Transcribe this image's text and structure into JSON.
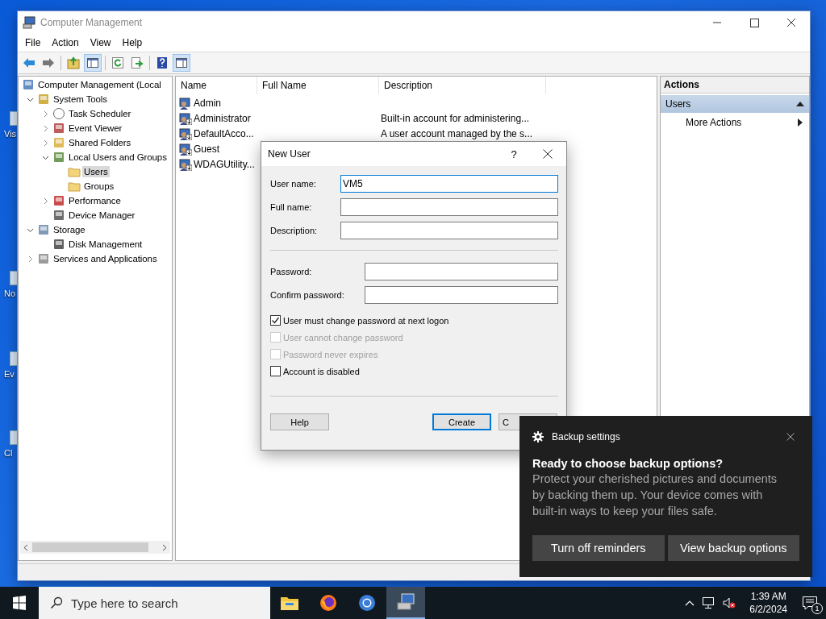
{
  "desktop_icons": [
    {
      "label": "Vis"
    },
    {
      "label": "No"
    },
    {
      "label": "Ev"
    },
    {
      "label": "Cl"
    }
  ],
  "window": {
    "title": "Computer Management"
  },
  "menu": [
    "File",
    "Action",
    "View",
    "Help"
  ],
  "toolbar": [
    [
      {
        "kind": "back",
        "on": false
      },
      {
        "kind": "forward",
        "on": false
      }
    ],
    [
      {
        "kind": "up",
        "on": false
      },
      {
        "kind": "tree",
        "on": true
      }
    ],
    [
      {
        "kind": "refresh",
        "on": false
      },
      {
        "kind": "export",
        "on": false
      }
    ],
    [
      {
        "kind": "help",
        "on": false
      },
      {
        "kind": "pane",
        "on": true
      }
    ]
  ],
  "tree": [
    {
      "label": "Computer Management (Local",
      "kind": "computer",
      "selected": false,
      "children": [
        {
          "label": "System Tools",
          "kind": "tools",
          "expanded": true,
          "selected": false,
          "children": [
            {
              "label": "Task Scheduler",
              "kind": "clock",
              "expanded": false,
              "selected": false
            },
            {
              "label": "Event Viewer",
              "kind": "event",
              "expanded": false,
              "selected": false
            },
            {
              "label": "Shared Folders",
              "kind": "share",
              "expanded": false,
              "selected": false
            },
            {
              "label": "Local Users and Groups",
              "kind": "users",
              "expanded": true,
              "selected": false,
              "children": [
                {
                  "label": "Users",
                  "kind": "folder",
                  "selected": true
                },
                {
                  "label": "Groups",
                  "kind": "folder",
                  "selected": false
                }
              ]
            },
            {
              "label": "Performance",
              "kind": "perf",
              "expanded": false,
              "selected": false
            },
            {
              "label": "Device Manager",
              "kind": "device",
              "selected": false
            }
          ]
        },
        {
          "label": "Storage",
          "kind": "storage",
          "expanded": true,
          "selected": false,
          "children": [
            {
              "label": "Disk Management",
              "kind": "disk",
              "selected": false
            }
          ]
        },
        {
          "label": "Services and Applications",
          "kind": "services",
          "expanded": false,
          "selected": false
        }
      ]
    }
  ],
  "list": {
    "columns": [
      "Name",
      "Full Name",
      "Description"
    ],
    "rows": [
      {
        "name": "Admin",
        "disabled": false
      },
      {
        "name": "Administrator",
        "description": "Built-in account for administering...",
        "disabled": true
      },
      {
        "name": "DefaultAcco...",
        "description": "A user account managed by the s...",
        "disabled": true
      },
      {
        "name": "Guest",
        "disabled": true
      },
      {
        "name": "WDAGUtility...",
        "disabled": true
      }
    ]
  },
  "actions": {
    "header": "Actions",
    "section": {
      "label": "Users",
      "expanded": true
    },
    "items": [
      "More Actions"
    ]
  },
  "dialog": {
    "title": "New User",
    "help": "?",
    "name_fields": [
      {
        "label": "User name:",
        "value": "VM5",
        "focused": true
      },
      {
        "label": "Full name:",
        "focused": false
      },
      {
        "label": "Description:",
        "focused": false
      }
    ],
    "password_fields": [
      {
        "label": "Password:",
        "focused": false
      },
      {
        "label": "Confirm password:",
        "focused": false
      }
    ],
    "checkboxes": [
      {
        "label": "User must change password at next logon",
        "checked": true,
        "disabled": false
      },
      {
        "label": "User cannot change password",
        "checked": false,
        "disabled": true
      },
      {
        "label": "Password never expires",
        "checked": false,
        "disabled": true
      },
      {
        "label": "Account is disabled",
        "checked": false,
        "disabled": false
      }
    ],
    "buttons": [
      {
        "label": "Help",
        "default": false
      },
      {
        "label": "Create",
        "default": true
      },
      {
        "label": "C",
        "default": false
      }
    ]
  },
  "toast": {
    "app": "Backup settings",
    "title": "Ready to choose backup options?",
    "body": "Protect your cherished pictures and documents by backing them up. Your device comes with built-in ways to keep your files safe.",
    "buttons": [
      "Turn off reminders",
      "View backup options"
    ]
  },
  "taskbar": {
    "search_placeholder": "Type here to search",
    "apps": [
      {
        "kind": "explorer",
        "active": false
      },
      {
        "kind": "firefox",
        "active": false
      },
      {
        "kind": "browser",
        "active": false
      },
      {
        "kind": "management",
        "active": true
      }
    ],
    "time": "1:39 AM",
    "date": "6/2/2024",
    "notifications": "1"
  }
}
